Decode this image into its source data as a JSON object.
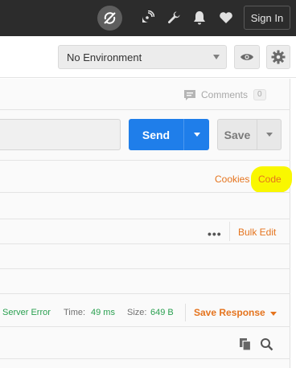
{
  "header": {
    "sign_in_label": "Sign In",
    "icons": [
      "sync-off-icon",
      "satellite-icon",
      "wrench-icon",
      "bell-icon",
      "heart-icon"
    ]
  },
  "environment": {
    "selected": "No Environment",
    "icons": [
      "eye-icon",
      "gear-icon"
    ]
  },
  "comments": {
    "label": "Comments",
    "count": "0"
  },
  "request": {
    "send_label": "Send",
    "save_label": "Save"
  },
  "links": {
    "cookies": "Cookies",
    "code": "Code"
  },
  "params": {
    "more_label": "•••",
    "bulk_edit": "Bulk Edit"
  },
  "response": {
    "status": "Server Error",
    "time_label": "Time:",
    "time_value": "49 ms",
    "size_label": "Size:",
    "size_value": "649 B",
    "save_response": "Save Response"
  },
  "colors": {
    "accent_blue": "#1f7eea",
    "link_orange": "#e5741e",
    "status_green": "#2aa050",
    "highlight_yellow": "#f9f700"
  }
}
